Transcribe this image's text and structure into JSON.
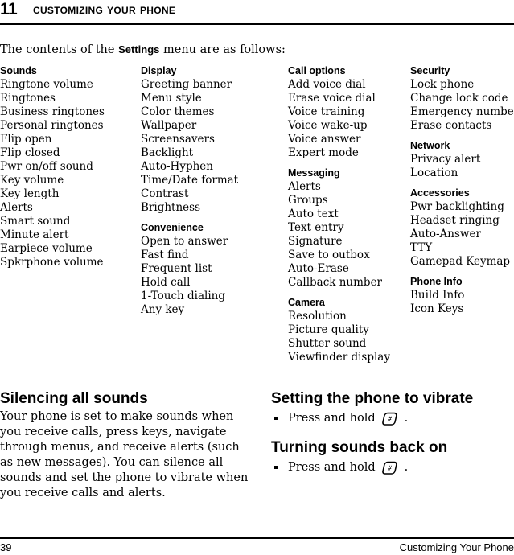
{
  "header": {
    "chapter_number": "11",
    "chapter_title": "Customizing Your Phone"
  },
  "intro": {
    "before": "The contents of the ",
    "emphasis": "Settings",
    "after": " menu are as follows:"
  },
  "menu_columns": [
    {
      "groups": [
        {
          "title": "Sounds",
          "items": [
            "Ringtone volume",
            "Ringtones",
            "Business ringtones",
            "Personal ringtones",
            "Flip open",
            "Flip closed",
            "Pwr on/off sound",
            "Key volume",
            "Key length",
            "Alerts",
            "Smart sound",
            "Minute alert",
            "Earpiece volume",
            "Spkrphone volume"
          ]
        }
      ]
    },
    {
      "groups": [
        {
          "title": "Display",
          "items": [
            "Greeting banner",
            "Menu style",
            "Color themes",
            "Wallpaper",
            "Screensavers",
            "Backlight",
            "Auto-Hyphen",
            "Time/Date format",
            "Contrast",
            "Brightness"
          ]
        },
        {
          "title": "Convenience",
          "items": [
            "Open to answer",
            "Fast find",
            "Frequent list",
            "Hold call",
            "1-Touch dialing",
            "Any key"
          ]
        }
      ]
    },
    {
      "groups": [
        {
          "title": "Call options",
          "items": [
            "Add voice dial",
            "Erase voice dial",
            "Voice training",
            "Voice wake-up",
            "Voice answer",
            "Expert mode"
          ]
        },
        {
          "title": "Messaging",
          "items": [
            "Alerts",
            "Groups",
            "Auto text",
            "Text entry",
            "Signature",
            "Save to outbox",
            "Auto-Erase",
            "Callback number"
          ]
        },
        {
          "title": "Camera",
          "items": [
            "Resolution",
            "Picture quality",
            "Shutter sound",
            "Viewfinder display"
          ]
        }
      ]
    },
    {
      "groups": [
        {
          "title": "Security",
          "items": [
            "Lock phone",
            "Change lock code",
            "Emergency numbers",
            "Erase contacts"
          ]
        },
        {
          "title": "Network",
          "items": [
            "Privacy alert",
            "Location"
          ]
        },
        {
          "title": "Accessories",
          "items": [
            "Pwr backlighting",
            "Headset ringing",
            "Auto-Answer",
            "TTY",
            "Gamepad Keymap"
          ]
        },
        {
          "title": "Phone Info",
          "items": [
            "Build Info",
            "Icon Keys"
          ]
        }
      ]
    }
  ],
  "sections": {
    "silencing": {
      "heading": "Silencing all sounds",
      "paragraph": "Your phone is set to make sounds when you receive calls, press keys, navigate through menus, and receive alerts (such as new messages). You can silence all sounds and set the phone to vibrate when you receive calls and alerts."
    },
    "vibrate": {
      "heading": "Setting the phone to vibrate",
      "bullet_text": "Press and hold",
      "key_icon": "pound-key-icon",
      "bullet_period": "."
    },
    "sounds_back_on": {
      "heading": "Turning sounds back on",
      "bullet_text": "Press and hold",
      "key_icon": "pound-key-icon",
      "bullet_period": "."
    }
  },
  "footer": {
    "page_number": "39",
    "chapter_label": "Customizing Your Phone"
  }
}
